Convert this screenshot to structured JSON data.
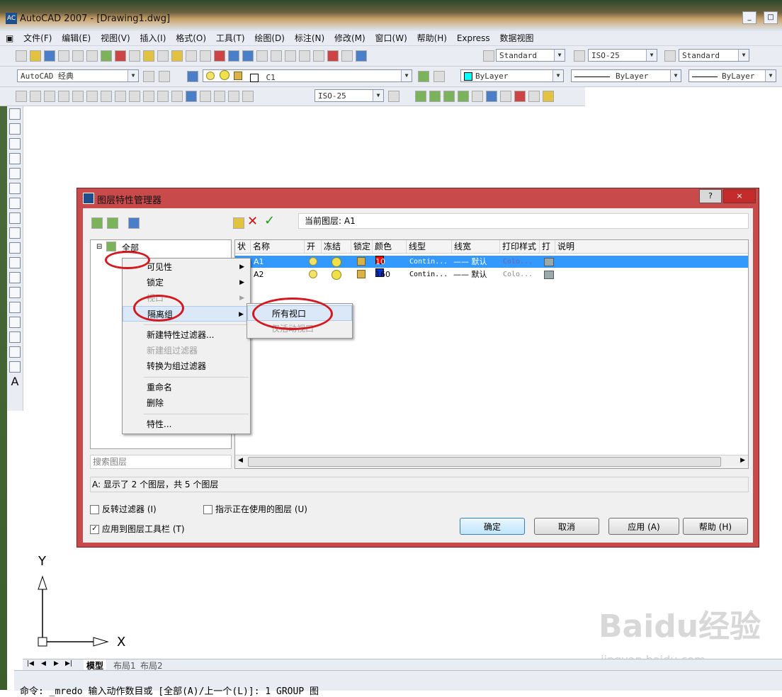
{
  "app": {
    "title": "AutoCAD 2007 - [Drawing1.dwg]",
    "icon_label": "AC",
    "window_buttons": [
      "_",
      "□",
      "×"
    ]
  },
  "menubar": [
    "文件(F)",
    "编辑(E)",
    "视图(V)",
    "插入(I)",
    "格式(O)",
    "工具(T)",
    "绘图(D)",
    "标注(N)",
    "修改(M)",
    "窗口(W)",
    "帮助(H)",
    "Express",
    "数据视图"
  ],
  "toolbars": {
    "text_style": "Standard",
    "dim_style": "ISO-25",
    "table_style": "Standard",
    "workspace": "AutoCAD 经典",
    "layer": "C1",
    "color": "ByLayer",
    "linetype": "ByLayer",
    "lineweight": "ByLayer",
    "dim_style2": "ISO-25"
  },
  "dialog": {
    "title": "图层特性管理器",
    "help_btn": "?",
    "close_btn": "×",
    "current_layer_label": "当前图层: A1",
    "tree_root": "全部",
    "search_placeholder": "搜索图层",
    "status_text": "A: 显示了 2 个图层，共 5 个图层",
    "columns": [
      "状",
      "名称",
      "开",
      "冻结",
      "锁定",
      "颜色",
      "线型",
      "线宽",
      "打印样式",
      "打",
      "说明"
    ],
    "rows": [
      {
        "name": "A1",
        "color_value": "10",
        "color_hex": "#ff0000",
        "linetype": "Contin...",
        "lineweight": "—— 默认",
        "plotstyle": "Colo...",
        "selected": true
      },
      {
        "name": "A2",
        "color_value": "160",
        "color_hex": "#0033cc",
        "linetype": "Contin...",
        "lineweight": "—— 默认",
        "plotstyle": "Colo...",
        "selected": false
      }
    ],
    "invert_filter": "反转过滤器 (I)",
    "indicate_in_use": "指示正在使用的图层 (U)",
    "apply_to_toolbar": "应用到图层工具栏 (T)",
    "buttons": {
      "ok": "确定",
      "cancel": "取消",
      "apply": "应用 (A)",
      "help": "帮助 (H)"
    }
  },
  "context_menu": {
    "items": [
      {
        "label": "可见性",
        "submenu": true,
        "disabled": false
      },
      {
        "label": "锁定",
        "submenu": true,
        "disabled": false
      },
      {
        "label": "视口",
        "submenu": true,
        "disabled": true
      },
      {
        "label": "隔离组",
        "submenu": true,
        "disabled": false
      },
      {
        "label": "新建特性过滤器...",
        "submenu": false,
        "disabled": false
      },
      {
        "label": "新建组过滤器",
        "submenu": false,
        "disabled": true
      },
      {
        "label": "转换为组过滤器",
        "submenu": false,
        "disabled": false
      },
      {
        "label": "重命名",
        "submenu": false,
        "disabled": false
      },
      {
        "label": "删除",
        "submenu": false,
        "disabled": false
      },
      {
        "label": "特性...",
        "submenu": false,
        "disabled": false
      }
    ],
    "submenu": [
      {
        "label": "所有视口",
        "disabled": false
      },
      {
        "label": "仅活动视口",
        "disabled": true
      }
    ]
  },
  "ucs": {
    "x_label": "X",
    "y_label": "Y"
  },
  "layout_tabs": [
    "模型",
    "布局1",
    "布局2"
  ],
  "command_line": "命令: _mredo 输入动作数目或 [全部(A)/上一个(L)]: 1 GROUP 图",
  "watermark": {
    "text": "Baidu经验",
    "url": "jingyan.baidu.com"
  },
  "colors": {
    "selection": "#3399ff",
    "dialog_frame": "#c94a4a",
    "annotation": "#d4181e"
  }
}
